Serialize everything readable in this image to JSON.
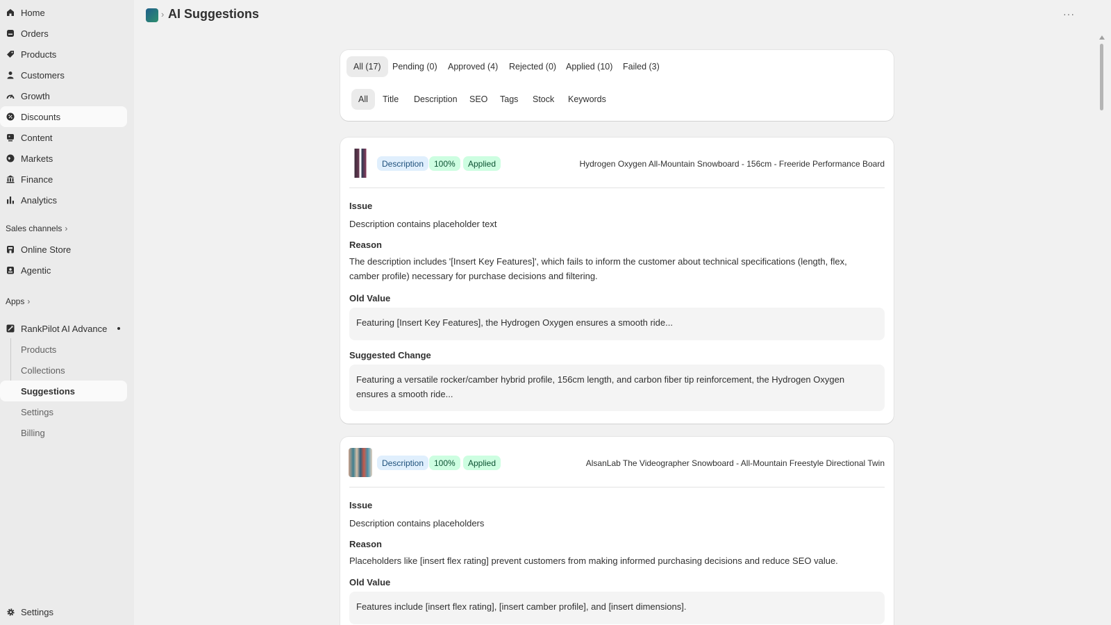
{
  "sidebar": {
    "main_items": [
      {
        "label": "Home",
        "icon": "home-icon"
      },
      {
        "label": "Orders",
        "icon": "orders-icon"
      },
      {
        "label": "Products",
        "icon": "tag-icon"
      },
      {
        "label": "Customers",
        "icon": "person-icon"
      },
      {
        "label": "Growth",
        "icon": "growth-icon"
      },
      {
        "label": "Discounts",
        "icon": "discount-icon"
      },
      {
        "label": "Content",
        "icon": "content-icon"
      },
      {
        "label": "Markets",
        "icon": "globe-icon"
      },
      {
        "label": "Finance",
        "icon": "bank-icon"
      },
      {
        "label": "Analytics",
        "icon": "bar-chart-icon"
      }
    ],
    "sales_channels_label": "Sales channels",
    "channels": [
      {
        "label": "Online Store",
        "icon": "store-icon"
      },
      {
        "label": "Agentic",
        "icon": "agent-icon"
      }
    ],
    "apps_label": "Apps",
    "app_name": "RankPilot AI Advance",
    "app_subitems": [
      {
        "label": "Products"
      },
      {
        "label": "Collections"
      },
      {
        "label": "Suggestions"
      },
      {
        "label": "Settings"
      },
      {
        "label": "Billing"
      }
    ],
    "settings_label": "Settings"
  },
  "header": {
    "title": "AI Suggestions",
    "separator": "›",
    "more": "···"
  },
  "status_tabs": [
    "All (17)",
    "Pending (0)",
    "Approved (4)",
    "Rejected (0)",
    "Applied (10)",
    "Failed (3)"
  ],
  "type_tabs": [
    "All",
    "Title",
    "Description",
    "SEO",
    "Tags",
    "Stock",
    "Keywords"
  ],
  "suggestions": [
    {
      "type": "Description",
      "confidence": "100%",
      "status": "Applied",
      "product": "Hydrogen Oxygen All-Mountain Snowboard - 156cm - Freeride Performance Board",
      "issue_label": "Issue",
      "issue": "Description contains placeholder text",
      "reason_label": "Reason",
      "reason": "The description includes '[Insert Key Features]', which fails to inform the customer about technical specifications (length, flex, camber profile) necessary for purchase decisions and filtering.",
      "old_label": "Old Value",
      "old_value": "Featuring [Insert Key Features], the Hydrogen Oxygen ensures a smooth ride...",
      "suggested_label": "Suggested Change",
      "suggested_value": "Featuring a versatile rocker/camber hybrid profile, 156cm length, and carbon fiber tip reinforcement, the Hydrogen Oxygen ensures a smooth ride..."
    },
    {
      "type": "Description",
      "confidence": "100%",
      "status": "Applied",
      "product": "AlsanLab The Videographer Snowboard - All-Mountain Freestyle Directional Twin",
      "issue_label": "Issue",
      "issue": "Description contains placeholders",
      "reason_label": "Reason",
      "reason": "Placeholders like [insert flex rating] prevent customers from making informed purchasing decisions and reduce SEO value.",
      "old_label": "Old Value",
      "old_value": "Features include [insert flex rating], [insert camber profile], and [insert dimensions]."
    }
  ],
  "colors": {
    "sidebar_bg": "#ebebeb",
    "page_bg": "#f1f1f1",
    "type_badge": "#e0effd",
    "applied_badge": "#cdfee1"
  }
}
